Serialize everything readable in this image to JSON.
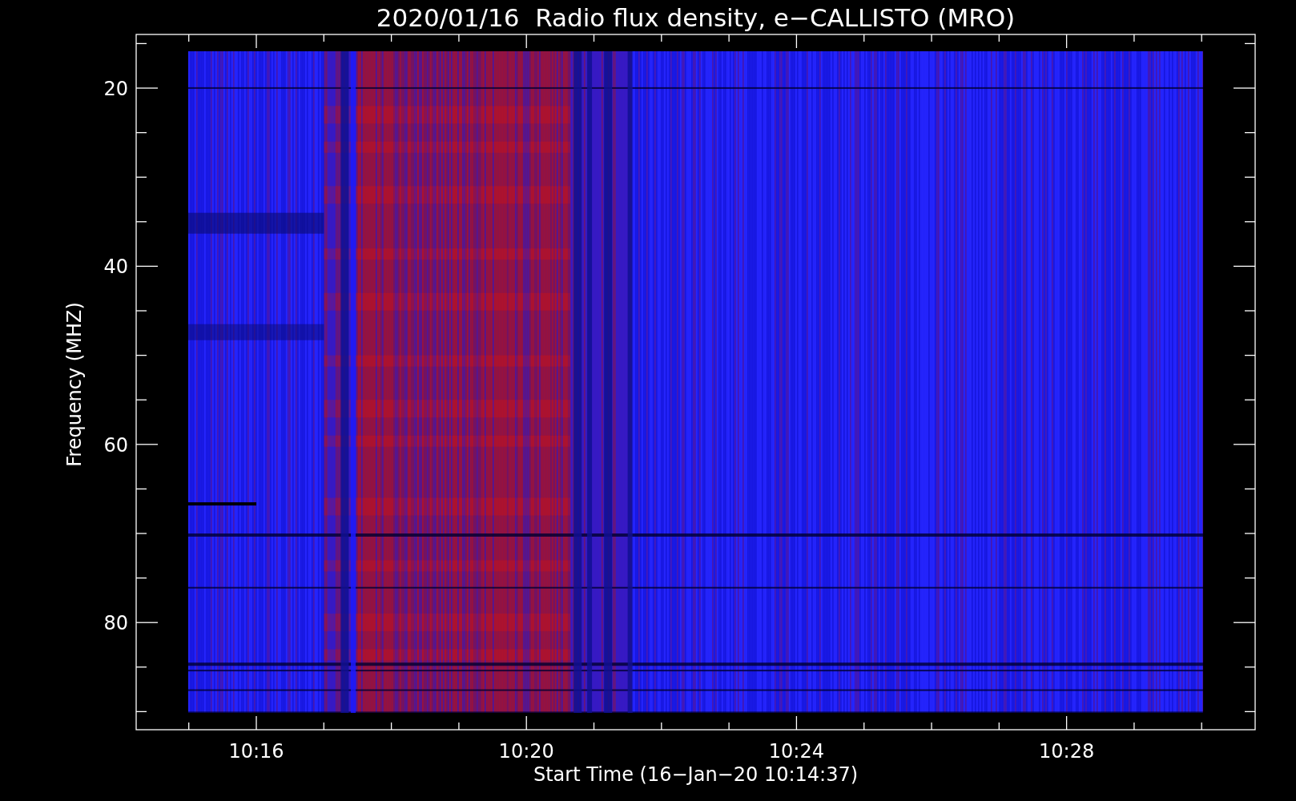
{
  "title": "2020/01/16  Radio flux density, e−CALLISTO (MRO)",
  "y_axis": {
    "label": "Frequency (MHZ)",
    "ticks": [
      "20",
      "40",
      "60",
      "80"
    ]
  },
  "x_axis": {
    "label": "Start Time (16−Jan−20 10:14:37)",
    "ticks": [
      "10:16",
      "10:20",
      "10:24",
      "10:28"
    ]
  }
}
